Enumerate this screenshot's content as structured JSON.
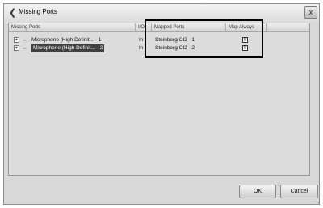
{
  "window": {
    "title": "Missing Ports",
    "close_label": "x"
  },
  "columns": {
    "missing_ports": "Missing Ports",
    "io": "I/O",
    "mapped_ports": "Mapped Ports",
    "map_always": "Map Always"
  },
  "rows": [
    {
      "expander": "+",
      "port": "Microphone (High Definit... - 1",
      "io": "In",
      "mapped": "Steinberg CI2 - 1",
      "map_always": true,
      "selected": false
    },
    {
      "expander": "+",
      "port": "Microphone (High Definit... - 2",
      "io": "In",
      "mapped": "Steinberg CI2 - 2",
      "map_always": true,
      "selected": true
    }
  ],
  "buttons": {
    "ok": "OK",
    "cancel": "Cancel"
  }
}
